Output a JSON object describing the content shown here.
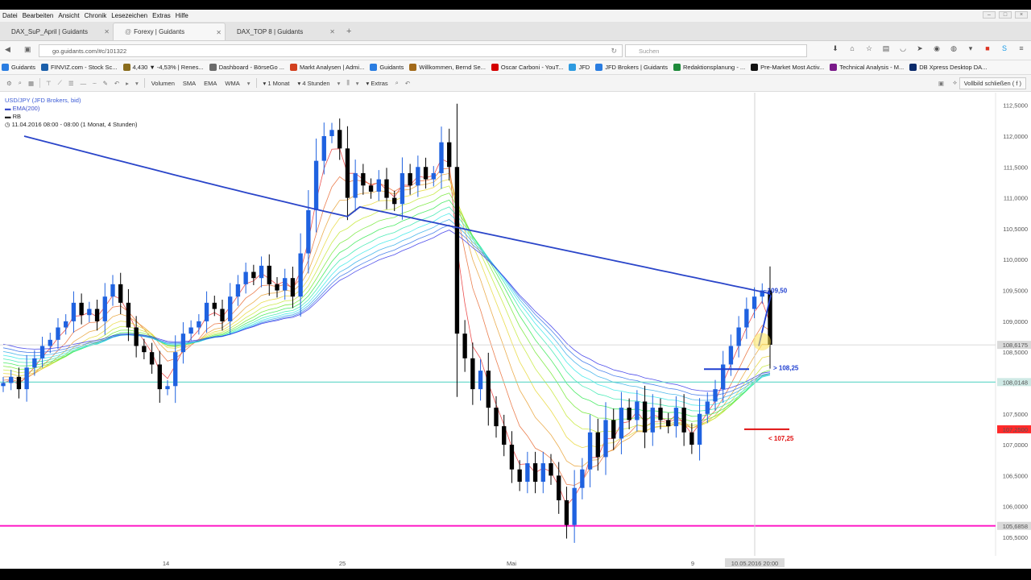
{
  "menu": [
    "Datei",
    "Bearbeiten",
    "Ansicht",
    "Chronik",
    "Lesezeichen",
    "Extras",
    "Hilfe"
  ],
  "tabs": [
    {
      "label": "DAX_SuP_April | Guidants",
      "active": false
    },
    {
      "label": "Forexy | Guidants",
      "active": true
    },
    {
      "label": "DAX_TOP 8 | Guidants",
      "active": false
    }
  ],
  "nav": {
    "url": "go.guidants.com/#c/101322",
    "search_placeholder": "Suchen"
  },
  "bookmarks": [
    {
      "label": "Guidants",
      "color": "#2a7de1"
    },
    {
      "label": "FINVIZ.com - Stock Sc...",
      "color": "#1b5faa"
    },
    {
      "label": "4,430 ▼ -4,53% | Renes...",
      "color": "#8a6d1d"
    },
    {
      "label": "Dashboard - BörseGo ...",
      "color": "#6b6b6b"
    },
    {
      "label": "Markt Analysen | Admi...",
      "color": "#d2401f"
    },
    {
      "label": "Guidants",
      "color": "#2a7de1"
    },
    {
      "label": "Willkommen, Bernd Se...",
      "color": "#a26a1a"
    },
    {
      "label": "Oscar Carboni - YouT...",
      "color": "#d40000"
    },
    {
      "label": "JFD",
      "color": "#2e9be0"
    },
    {
      "label": "JFD Brokers | Guidants",
      "color": "#2a7de1"
    },
    {
      "label": "Redaktionsplanung - ...",
      "color": "#1e8a3a"
    },
    {
      "label": "Pre-Market Most Activ...",
      "color": "#111111"
    },
    {
      "label": "Technical Analysis - M...",
      "color": "#7a1a8a"
    },
    {
      "label": "DB Xpress Desktop DA...",
      "color": "#0a2a6a"
    }
  ],
  "toolbar": {
    "items": [
      "Volumen",
      "SMA",
      "EMA",
      "WMA",
      "1 Monat",
      "4 Stunden",
      "Extras"
    ],
    "fullscreen": "Vollbild schließen ( f )"
  },
  "legend": {
    "symbol": "USD/JPY (JFD Brokers, bid)",
    "ema": "EMA(200)",
    "rb": "RB",
    "date": "11.04.2016 08:00 - 08:00 (1 Monat, 4 Stunden)"
  },
  "colors": {
    "ema": "#2a45c9",
    "up": "#1f62e0",
    "down": "#000000",
    "support_line": "#5fd6c8",
    "low_line": "#ff1fc8",
    "target": "#1f3fd0",
    "stop": "#e01010"
  },
  "annotations": {
    "target": "~109,50",
    "mid": "> 108,25",
    "stop": "< 107,25"
  },
  "price_axis": [
    "112,5000",
    "112,0000",
    "111,5000",
    "111,0000",
    "110,5000",
    "110,0000",
    "109,5000",
    "109,0000",
    "108,5000",
    "108,0000",
    "107,5000",
    "107,0000",
    "106,5000",
    "106,0000",
    "105,5000"
  ],
  "price_axis_markers": {
    "current": {
      "label": "108,6175",
      "price": 108.6175,
      "color": "#dadada"
    },
    "support": {
      "label": "108,0148",
      "price": 108.0148,
      "color": "#cfe9e5"
    },
    "stop": {
      "label": "107,2500",
      "price": 107.25,
      "color": "#ff2a2a"
    },
    "low": {
      "label": "105,6858",
      "price": 105.6858,
      "color": "#dadada"
    }
  },
  "time_axis": {
    "ticks": [
      "14",
      "25",
      "Mai",
      "9"
    ],
    "crosshair_label": "10.05.2016 20:00"
  },
  "chart_data": {
    "type": "candlestick",
    "symbol": "USD/JPY",
    "ylim": [
      105.2,
      112.6
    ],
    "y_ticks": [
      112.5,
      112.0,
      111.5,
      111.0,
      110.5,
      110.0,
      109.5,
      109.0,
      108.5,
      108.0,
      107.5,
      107.0,
      106.5,
      106.0,
      105.5
    ],
    "closes": [
      108.0,
      108.1,
      107.9,
      108.25,
      108.4,
      108.6,
      108.7,
      108.9,
      109.0,
      109.3,
      109.1,
      109.2,
      109.0,
      109.4,
      109.6,
      109.3,
      108.9,
      108.6,
      108.5,
      108.3,
      107.9,
      107.95,
      108.5,
      108.8,
      108.9,
      109.0,
      109.3,
      109.2,
      109.0,
      109.4,
      109.6,
      109.8,
      109.7,
      109.9,
      109.6,
      109.5,
      109.7,
      109.4,
      110.1,
      110.8,
      111.6,
      112.0,
      112.1,
      111.8,
      111.0,
      111.4,
      111.2,
      111.1,
      111.3,
      111.0,
      110.9,
      111.4,
      111.2,
      111.5,
      111.3,
      111.4,
      111.9,
      111.5,
      108.8,
      108.4,
      107.9,
      108.2,
      107.6,
      107.3,
      107.0,
      106.6,
      106.4,
      106.7,
      106.4,
      106.7,
      106.5,
      106.1,
      105.7,
      106.3,
      106.6,
      107.2,
      106.8,
      107.4,
      107.1,
      107.6,
      107.4,
      107.7,
      107.2,
      107.6,
      107.4,
      107.3,
      107.6,
      107.2,
      107.0,
      107.5,
      107.7,
      107.9,
      108.3,
      108.6,
      108.9,
      109.2,
      109.4,
      109.5,
      108.62
    ],
    "ema200": {
      "start": 112.0,
      "end": 109.45
    },
    "levels": {
      "support": 108.0148,
      "low": 105.6858,
      "current": 108.6175,
      "target": 109.5,
      "mid": 108.25,
      "stop": 107.25
    },
    "ribbon": {
      "type": "EMA ribbon",
      "legend": "RB"
    }
  }
}
